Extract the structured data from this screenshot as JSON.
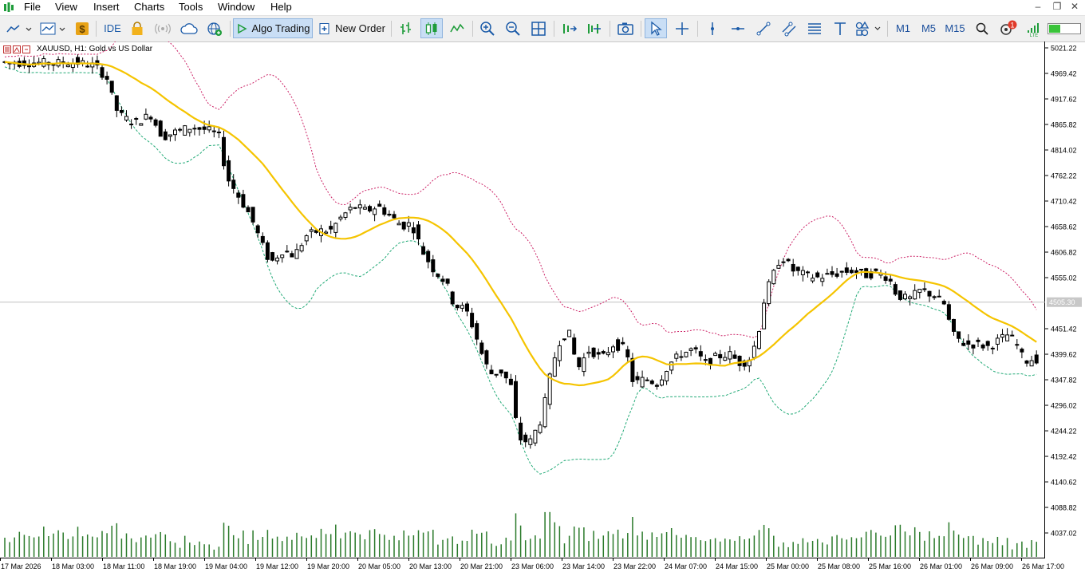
{
  "menu": [
    "File",
    "View",
    "Insert",
    "Charts",
    "Tools",
    "Window",
    "Help"
  ],
  "toolbar": {
    "ide_label": "IDE",
    "algo_label": "Algo Trading",
    "order_label": "New Order",
    "timeframes": [
      "M1",
      "M5",
      "M15"
    ],
    "notification_count": "1"
  },
  "chart": {
    "title": "XAUUSD, H1:  Gold vs US Dollar",
    "current_price": "4505.30",
    "colors": {
      "bull_body": "#ffffff",
      "bear_body": "#000000",
      "ma": "#f5c400",
      "upper_band": "#cc2266",
      "lower_band": "#22aa77",
      "volume": "#2a7a2a",
      "price_line": "#c0c0c0"
    }
  },
  "price_axis": [
    "5021.22",
    "4969.42",
    "4917.62",
    "4865.82",
    "4814.02",
    "4762.22",
    "4710.42",
    "4658.62",
    "4606.82",
    "4555.02",
    "4451.42",
    "4399.62",
    "4347.82",
    "4296.02",
    "4244.22",
    "4192.42",
    "4140.62",
    "4088.82",
    "4037.02"
  ],
  "time_axis": [
    "17 Mar 2026",
    "18 Mar 03:00",
    "18 Mar 11:00",
    "18 Mar 19:00",
    "19 Mar 04:00",
    "19 Mar 12:00",
    "19 Mar 20:00",
    "20 Mar 05:00",
    "20 Mar 13:00",
    "20 Mar 21:00",
    "23 Mar 06:00",
    "23 Mar 14:00",
    "23 Mar 22:00",
    "24 Mar 07:00",
    "24 Mar 15:00",
    "25 Mar 00:00",
    "25 Mar 08:00",
    "25 Mar 16:00",
    "26 Mar 01:00",
    "26 Mar 09:00",
    "26 Mar 17:00"
  ]
}
